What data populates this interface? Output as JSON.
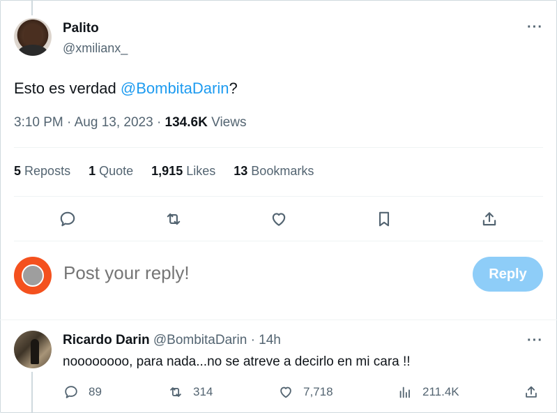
{
  "tweet": {
    "author_name": "Palito",
    "author_handle": "@xmilianx_",
    "text_prefix": "Esto es verdad ",
    "mention": "@BombitaDarin",
    "text_suffix": "?",
    "time": "3:10 PM",
    "date": "Aug 13, 2023",
    "views_count": "134.6K",
    "views_label": "Views",
    "more_label": "···"
  },
  "stats": {
    "reposts_count": "5",
    "reposts_label": "Reposts",
    "quote_count": "1",
    "quote_label": "Quote",
    "likes_count": "1,915",
    "likes_label": "Likes",
    "bookmarks_count": "13",
    "bookmarks_label": "Bookmarks"
  },
  "actions": [
    "reply-icon",
    "repost-icon",
    "like-icon",
    "bookmark-icon",
    "share-icon"
  ],
  "composer": {
    "placeholder": "Post your reply!",
    "button_label": "Reply",
    "button_color": "#8ecdf8",
    "avatar_color": "#f4511e"
  },
  "reply": {
    "author_name": "Ricardo Darin",
    "author_handle": "@BombitaDarin",
    "separator": "·",
    "age": "14h",
    "text": "noooooooo, para nada...no se atreve a decirlo en mi cara !!",
    "more_label": "···",
    "replies": "89",
    "reposts": "314",
    "likes": "7,718",
    "views": "211.4K"
  },
  "colors": {
    "accent": "#1d9bf0",
    "muted": "#536471",
    "text": "#0f1419"
  }
}
